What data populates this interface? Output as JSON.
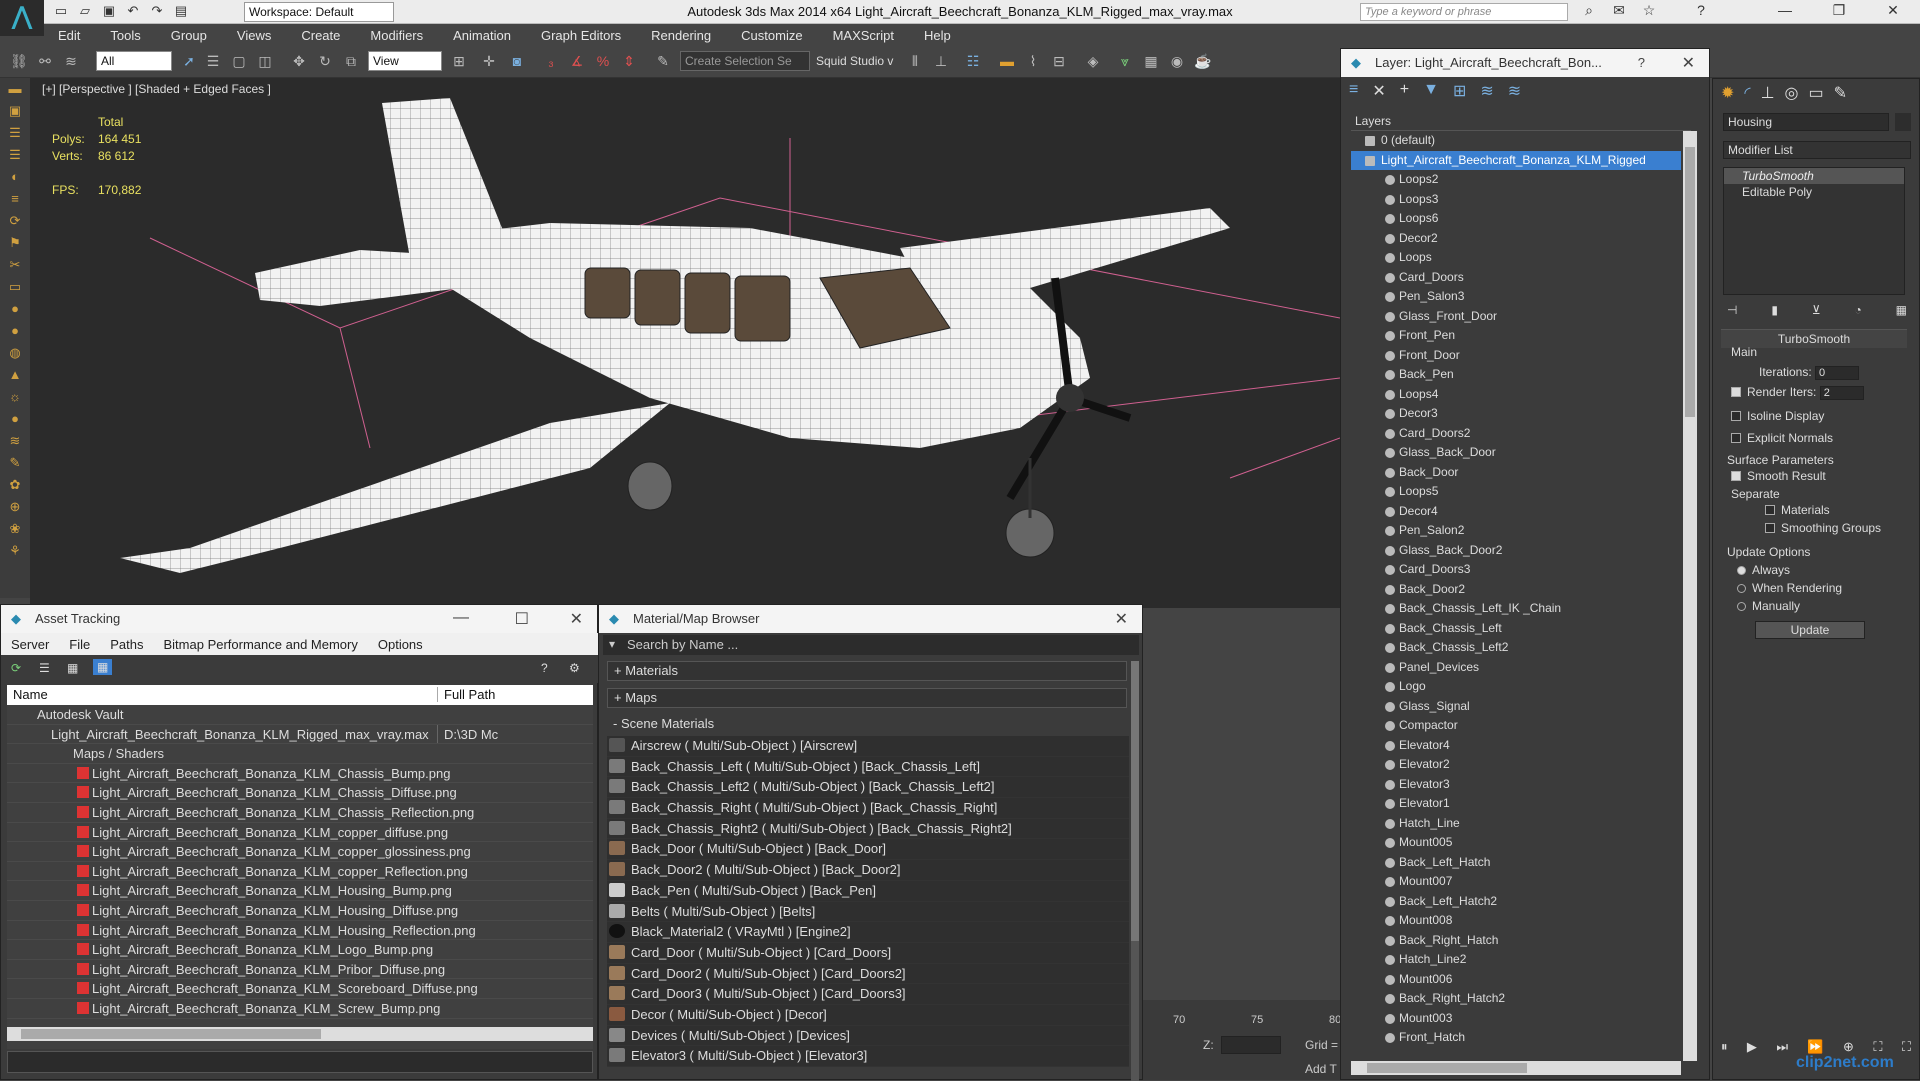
{
  "app": {
    "title": "Autodesk 3ds Max  2014 x64     Light_Aircraft_Beechcraft_Bonanza_KLM_Rigged_max_vray.max",
    "workspace": "Workspace: Default",
    "search_placeholder": "Type a keyword or phrase",
    "watermark": "clip2net.com"
  },
  "menu": [
    "Edit",
    "Tools",
    "Group",
    "Views",
    "Create",
    "Modifiers",
    "Animation",
    "Graph Editors",
    "Rendering",
    "Customize",
    "MAXScript",
    "Help"
  ],
  "toolbar": {
    "filter": "All",
    "refcoord": "View",
    "selset": "Create Selection Se",
    "studio": "Squid Studio v"
  },
  "viewport": {
    "label": "[+] [Perspective ] [Shaded + Edged Faces ]",
    "stats_header": "Total",
    "polys_label": "Polys:",
    "polys": "164 451",
    "verts_label": "Verts:",
    "verts": "86 612",
    "fps_label": "FPS:",
    "fps": "170,882"
  },
  "asset_tracking": {
    "title": "Asset Tracking",
    "menu": [
      "Server",
      "File",
      "Paths",
      "Bitmap Performance and Memory",
      "Options"
    ],
    "col_name": "Name",
    "col_path": "Full Path",
    "rows": [
      {
        "name": "Autodesk Vault",
        "path": ""
      },
      {
        "name": "Light_Aircraft_Beechcraft_Bonanza_KLM_Rigged_max_vray.max",
        "path": "D:\\3D Mc"
      },
      {
        "name": "Maps / Shaders",
        "path": ""
      },
      {
        "name": "Light_Aircraft_Beechcraft_Bonanza_KLM_Chassis_Bump.png",
        "path": ""
      },
      {
        "name": "Light_Aircraft_Beechcraft_Bonanza_KLM_Chassis_Diffuse.png",
        "path": ""
      },
      {
        "name": "Light_Aircraft_Beechcraft_Bonanza_KLM_Chassis_Reflection.png",
        "path": ""
      },
      {
        "name": "Light_Aircraft_Beechcraft_Bonanza_KLM_copper_diffuse.png",
        "path": ""
      },
      {
        "name": "Light_Aircraft_Beechcraft_Bonanza_KLM_copper_glossiness.png",
        "path": ""
      },
      {
        "name": "Light_Aircraft_Beechcraft_Bonanza_KLM_copper_Reflection.png",
        "path": ""
      },
      {
        "name": "Light_Aircraft_Beechcraft_Bonanza_KLM_Housing_Bump.png",
        "path": ""
      },
      {
        "name": "Light_Aircraft_Beechcraft_Bonanza_KLM_Housing_Diffuse.png",
        "path": ""
      },
      {
        "name": "Light_Aircraft_Beechcraft_Bonanza_KLM_Housing_Reflection.png",
        "path": ""
      },
      {
        "name": "Light_Aircraft_Beechcraft_Bonanza_KLM_Logo_Bump.png",
        "path": ""
      },
      {
        "name": "Light_Aircraft_Beechcraft_Bonanza_KLM_Pribor_Diffuse.png",
        "path": ""
      },
      {
        "name": "Light_Aircraft_Beechcraft_Bonanza_KLM_Scoreboard_Diffuse.png",
        "path": ""
      },
      {
        "name": "Light_Aircraft_Beechcraft_Bonanza_KLM_Screw_Bump.png",
        "path": ""
      }
    ]
  },
  "material_browser": {
    "title": "Material/Map Browser",
    "search_placeholder": "Search by Name ...",
    "sections": [
      "+ Materials",
      "+ Maps",
      "- Scene Materials"
    ],
    "materials": [
      "Airscrew  ( Multi/Sub-Object )  [Airscrew]",
      "Back_Chassis_Left  ( Multi/Sub-Object )  [Back_Chassis_Left]",
      "Back_Chassis_Left2  ( Multi/Sub-Object )  [Back_Chassis_Left2]",
      "Back_Chassis_Right  ( Multi/Sub-Object )  [Back_Chassis_Right]",
      "Back_Chassis_Right2  ( Multi/Sub-Object )  [Back_Chassis_Right2]",
      "Back_Door  ( Multi/Sub-Object )  [Back_Door]",
      "Back_Door2  ( Multi/Sub-Object )  [Back_Door2]",
      "Back_Pen  ( Multi/Sub-Object )  [Back_Pen]",
      "Belts  ( Multi/Sub-Object )  [Belts]",
      "Black_Material2  ( VRayMtl )  [Engine2]",
      "Card_Door  ( Multi/Sub-Object )  [Card_Doors]",
      "Card_Door2  ( Multi/Sub-Object )  [Card_Doors2]",
      "Card_Door3  ( Multi/Sub-Object )  [Card_Doors3]",
      "Decor  ( Multi/Sub-Object )  [Decor]",
      "Devices  ( Multi/Sub-Object )  [Devices]",
      "Elevator3  ( Multi/Sub-Object )  [Elevator3]"
    ]
  },
  "layer_panel": {
    "title": "Layer: Light_Aircraft_Beechcraft_Bon...",
    "header": "Layers",
    "default_layer": "0 (default)",
    "selected_layer": "Light_Aircraft_Beechcraft_Bonanza_KLM_Rigged",
    "items": [
      "Loops2",
      "Loops3",
      "Loops6",
      "Decor2",
      "Loops",
      "Card_Doors",
      "Pen_Salon3",
      "Glass_Front_Door",
      "Front_Pen",
      "Front_Door",
      "Back_Pen",
      "Loops4",
      "Decor3",
      "Card_Doors2",
      "Glass_Back_Door",
      "Back_Door",
      "Loops5",
      "Decor4",
      "Pen_Salon2",
      "Glass_Back_Door2",
      "Card_Doors3",
      "Back_Door2",
      "Back_Chassis_Left_IK _Chain",
      "Back_Chassis_Left",
      "Back_Chassis_Left2",
      "Panel_Devices",
      "Logo",
      "Glass_Signal",
      "Compactor",
      "Elevator4",
      "Elevator2",
      "Elevator3",
      "Elevator1",
      "Hatch_Line",
      "Mount005",
      "Back_Left_Hatch",
      "Mount007",
      "Back_Left_Hatch2",
      "Mount008",
      "Back_Right_Hatch",
      "Hatch_Line2",
      "Mount006",
      "Back_Right_Hatch2",
      "Mount003",
      "Front_Hatch"
    ]
  },
  "command_panel": {
    "object_name": "Housing",
    "modifier_list": "Modifier List",
    "stack": [
      "TurboSmooth",
      "Editable Poly"
    ],
    "rollout_title": "TurboSmooth",
    "main_label": "Main",
    "iterations_label": "Iterations:",
    "iterations": "0",
    "render_iters_label": "Render Iters:",
    "render_iters": "2",
    "isoline": "Isoline Display",
    "explicit_normals": "Explicit Normals",
    "surface_params": "Surface Parameters",
    "smooth_result": "Smooth Result",
    "separate": "Separate",
    "materials": "Materials",
    "smoothing_groups": "Smoothing Groups",
    "update_options": "Update Options",
    "always": "Always",
    "when_rendering": "When Rendering",
    "manually": "Manually",
    "update_btn": "Update"
  },
  "timeline": {
    "ticks": [
      "70",
      "75",
      "80"
    ],
    "z_label": "Z:",
    "grid_label": "Grid =",
    "add_t": "Add T"
  }
}
